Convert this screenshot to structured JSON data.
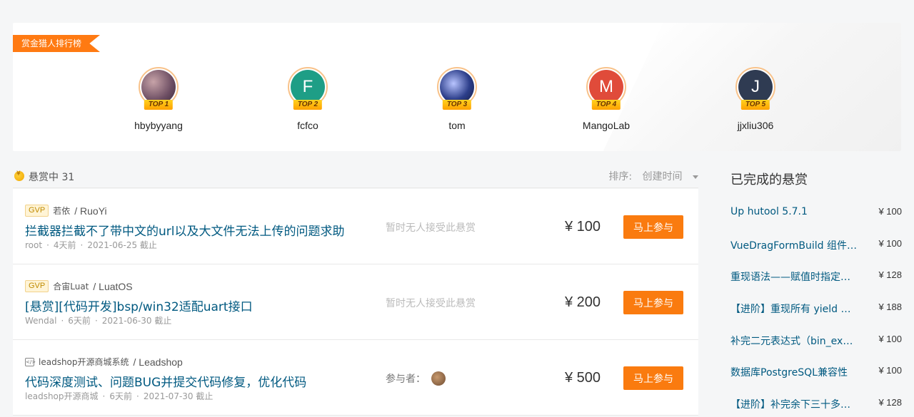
{
  "ranking": {
    "tag": "赏金猎人排行榜",
    "hunters": [
      {
        "name": "hbybyyang",
        "rank": "TOP 1",
        "initial": "",
        "color": "#8a6a7a"
      },
      {
        "name": "fcfco",
        "rank": "TOP 2",
        "initial": "F",
        "color": "#1e9e86"
      },
      {
        "name": "tom",
        "rank": "TOP 3",
        "initial": "",
        "color": "#2c3e8a"
      },
      {
        "name": "MangoLab",
        "rank": "TOP 4",
        "initial": "M",
        "color": "#e04b3a"
      },
      {
        "name": "jjxliu306",
        "rank": "TOP 5",
        "initial": "J",
        "color": "#2f3b52"
      }
    ]
  },
  "list": {
    "state_label": "悬赏中 31",
    "sort_label": "排序:",
    "sort_value": "创建时间"
  },
  "bounties": [
    {
      "badge": "GVP",
      "org": "若依",
      "repo": "/ RuoYi",
      "title": "拦截器拦截不了带中文的url以及大文件无法上传的问题求助",
      "author": "root",
      "ago": "4天前",
      "deadline": "2021-06-25 截止",
      "status": "暂时无人接受此悬赏",
      "price": "¥ 100",
      "action": "马上参与"
    },
    {
      "badge": "GVP",
      "org": "合宙Luat",
      "repo": "/ LuatOS",
      "title": "[悬赏][代码开发]bsp/win32适配uart接口",
      "author": "Wendal",
      "ago": "6天前",
      "deadline": "2021-06-30 截止",
      "status": "暂时无人接受此悬赏",
      "price": "¥ 200",
      "action": "马上参与"
    },
    {
      "badge": "",
      "org": "leadshop开源商城系统",
      "repo": "/ Leadshop",
      "title": "代码深度测试、问题BUG并提交代码修复，优化代码",
      "author": "leadshop开源商城",
      "ago": "6天前",
      "deadline": "2021-07-30 截止",
      "status": "参与者：",
      "price": "¥ 500",
      "action": "马上参与"
    }
  ],
  "sidebar": {
    "title": "已完成的悬赏",
    "items": [
      {
        "title": "Up hutool 5.7.1",
        "price": "¥ 100"
      },
      {
        "title": "VueDragFormBuild 组件 …",
        "price": "¥ 100"
      },
      {
        "title": "重现语法——赋值时指定…",
        "price": "¥ 128"
      },
      {
        "title": "【进阶】重现所有 yield 相…",
        "price": "¥ 188"
      },
      {
        "title": "补完二元表达式（bin_exp…",
        "price": "¥ 100"
      },
      {
        "title": "数据库PostgreSQL兼容性",
        "price": "¥ 100"
      },
      {
        "title": "【进阶】补完余下三十多…",
        "price": "¥ 128"
      }
    ]
  }
}
